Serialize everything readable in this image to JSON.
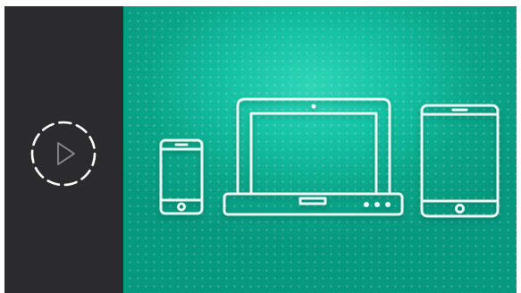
{
  "player": {
    "play_button_icon": "play-icon",
    "loading_ring_icon": "dashed-circle-icon"
  },
  "hero": {
    "background_color": "#15c2a3",
    "devices": [
      "smartphone-icon",
      "laptop-icon",
      "tablet-icon"
    ]
  },
  "colors": {
    "sidebar": "#2b2b2d",
    "accent": "#15c2a3",
    "device_stroke": "#e9f8f4"
  }
}
